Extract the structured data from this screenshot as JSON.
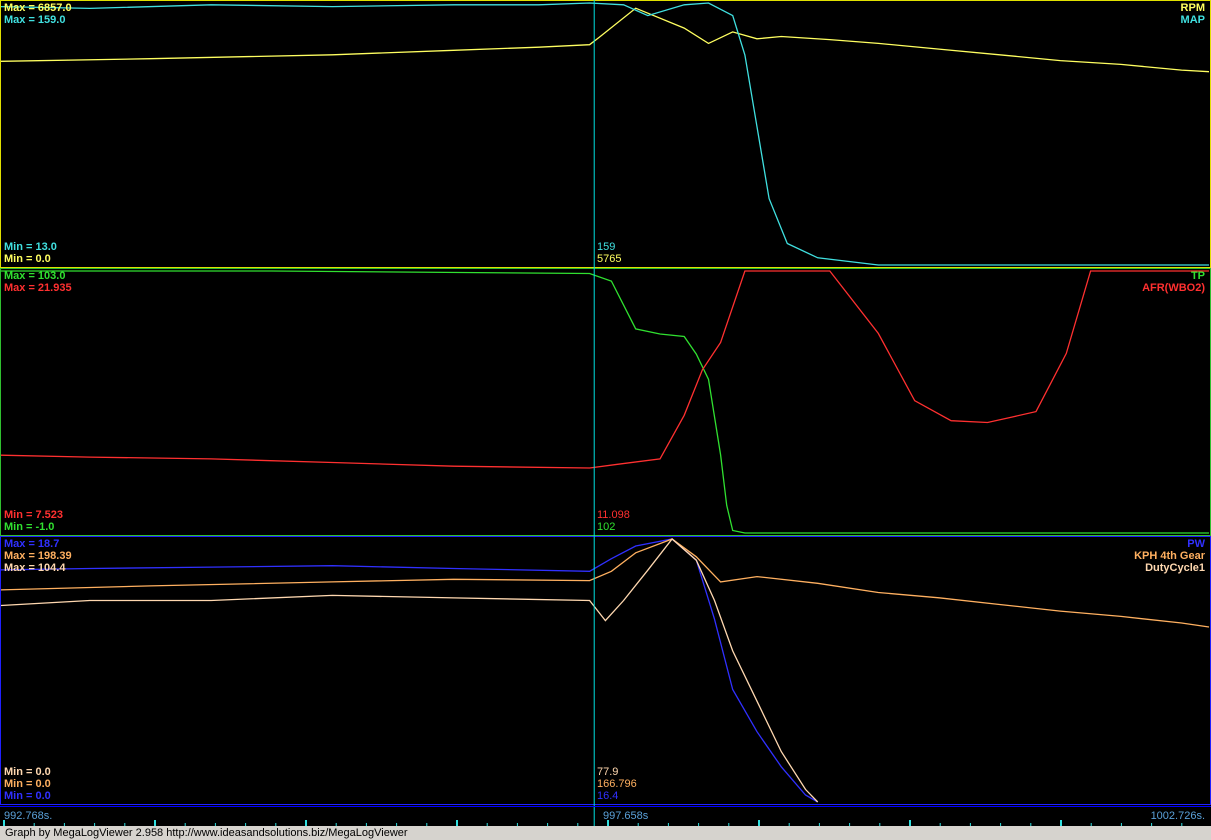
{
  "footer_text": "Graph by MegaLogViewer 2.958 http://www.ideasandsolutions.biz/MegaLogViewer",
  "x_axis": {
    "start_label": "992.768s.",
    "cursor_label": "997.658s",
    "end_label": "1002.726s.",
    "start": 992.768,
    "cursor": 997.658,
    "end": 1002.726
  },
  "colors": {
    "panel_border": "#ffff00",
    "cursor": "#00e0e0",
    "axis_line": "#0000ff",
    "bottom_border": "#2020ff"
  },
  "panels": [
    {
      "border_color": "#e0e000",
      "maxes": [
        {
          "text": "Max = 6857.0",
          "color": "#ffff60"
        },
        {
          "text": "Max = 159.0",
          "color": "#40e0e0"
        }
      ],
      "mins": [
        {
          "text": "Min = 13.0",
          "color": "#40e0e0"
        },
        {
          "text": "Min = 0.0",
          "color": "#ffff60"
        }
      ],
      "names": [
        {
          "text": "RPM",
          "color": "#ffff60"
        },
        {
          "text": "MAP",
          "color": "#40e0e0"
        }
      ],
      "cursor_values": [
        {
          "text": "159",
          "color": "#40e0e0"
        },
        {
          "text": "5765",
          "color": "#ffff60"
        }
      ]
    },
    {
      "border_color": "#30c030",
      "maxes": [
        {
          "text": "Max = 103.0",
          "color": "#30e030"
        },
        {
          "text": "Max = 21.935",
          "color": "#ff3030"
        }
      ],
      "mins": [
        {
          "text": "Min = 7.523",
          "color": "#ff3030"
        },
        {
          "text": "Min = -1.0",
          "color": "#30e030"
        }
      ],
      "names": [
        {
          "text": "TP",
          "color": "#30e030"
        },
        {
          "text": "AFR(WBO2)",
          "color": "#ff3030"
        }
      ],
      "cursor_values": [
        {
          "text": "11.098",
          "color": "#ff3030"
        },
        {
          "text": "102",
          "color": "#30e030"
        }
      ]
    },
    {
      "border_color": "#2020ff",
      "maxes": [
        {
          "text": "Max = 18.7",
          "color": "#3030ff"
        },
        {
          "text": "Max = 198.39",
          "color": "#ffb060"
        },
        {
          "text": "Max = 104.4",
          "color": "#ffd8b0"
        }
      ],
      "mins": [
        {
          "text": "Min = 0.0",
          "color": "#ffd8b0"
        },
        {
          "text": "Min = 0.0",
          "color": "#ffb060"
        },
        {
          "text": "Min = 0.0",
          "color": "#3030ff"
        }
      ],
      "names": [
        {
          "text": "PW",
          "color": "#3030ff"
        },
        {
          "text": "KPH 4th Gear",
          "color": "#ffb060"
        },
        {
          "text": "DutyCycle1",
          "color": "#ffd8b0"
        }
      ],
      "cursor_values": [
        {
          "text": "77.9",
          "color": "#ffd8b0"
        },
        {
          "text": "166.796",
          "color": "#ffb060"
        },
        {
          "text": "16.4",
          "color": "#3030ff"
        }
      ]
    }
  ],
  "chart_data": {
    "type": "line",
    "x_range": [
      992.768,
      1002.726
    ],
    "cursor_x": 997.658,
    "panels": [
      {
        "series": [
          {
            "name": "RPM",
            "color": "#ffff60",
            "range": [
              0,
              6857
            ],
            "x": [
              992.768,
              994.0,
              995.5,
              996.5,
              997.2,
              997.62,
              997.7,
              998.0,
              998.4,
              998.6,
              998.8,
              999.0,
              999.2,
              999.6,
              1000.0,
              1000.5,
              1001.0,
              1001.5,
              1002.0,
              1002.5,
              1002.726
            ],
            "y": [
              5330,
              5400,
              5500,
              5620,
              5700,
              5765,
              5960,
              6720,
              6200,
              5800,
              6100,
              5920,
              5980,
              5900,
              5800,
              5650,
              5500,
              5350,
              5250,
              5100,
              5060
            ]
          },
          {
            "name": "MAP",
            "color": "#40e0e0",
            "range": [
              13,
              159
            ],
            "x": [
              992.768,
              993.5,
              994.5,
              995.5,
              996.5,
              997.2,
              997.62,
              997.9,
              998.1,
              998.4,
              998.6,
              998.8,
              998.9,
              999.0,
              999.1,
              999.25,
              999.5,
              1000.0,
              1000.2,
              1000.5,
              1001.0,
              1002.0,
              1002.726
            ],
            "y": [
              157,
              156,
              158,
              157,
              158,
              158,
              159,
              158,
              152,
              158,
              159,
              152,
              130,
              90,
              50,
              25,
              17,
              13,
              13,
              13,
              13,
              13,
              13
            ]
          }
        ]
      },
      {
        "series": [
          {
            "name": "TP",
            "color": "#30e030",
            "range": [
              -1,
              103
            ],
            "x": [
              992.768,
              995.0,
              997.62,
              997.8,
              998.0,
              998.2,
              998.4,
              998.5,
              998.6,
              998.7,
              998.75,
              998.8,
              998.9,
              1000.0,
              1002.726
            ],
            "y": [
              103,
              103,
              102,
              99,
              80,
              78,
              77,
              70,
              60,
              30,
              10,
              0,
              -1,
              -1,
              -1
            ]
          },
          {
            "name": "AFR(WBO2)",
            "color": "#ff3030",
            "range": [
              7.523,
              21.935
            ],
            "x": [
              992.768,
              993.5,
              994.5,
              995.5,
              996.5,
              997.62,
              997.85,
              998.2,
              998.4,
              998.55,
              998.7,
              998.9,
              999.1,
              999.3,
              999.6,
              1000.0,
              1000.3,
              1000.6,
              1000.9,
              1001.1,
              1001.3,
              1001.55,
              1001.75,
              1002.726
            ],
            "y": [
              11.8,
              11.7,
              11.6,
              11.4,
              11.2,
              11.1,
              11.3,
              11.6,
              14.0,
              16.5,
              18.0,
              21.935,
              21.935,
              21.935,
              21.935,
              18.5,
              14.8,
              13.7,
              13.6,
              13.9,
              14.2,
              17.4,
              21.935,
              21.935
            ]
          }
        ]
      },
      {
        "series": [
          {
            "name": "PW",
            "color": "#3030ff",
            "range": [
              0,
              18.7
            ],
            "x": [
              992.768,
              993.5,
              994.5,
              995.5,
              996.5,
              997.62,
              997.8,
              998.0,
              998.3,
              998.5,
              998.65,
              998.8,
              999.0,
              999.2,
              999.4,
              999.5
            ],
            "y": [
              16.5,
              16.6,
              16.7,
              16.8,
              16.6,
              16.4,
              17.3,
              18.2,
              18.7,
              17.2,
              13.0,
              8.0,
              5.0,
              2.5,
              0.5,
              0
            ]
          },
          {
            "name": "KPH 4th Gear",
            "color": "#ffb060",
            "range": [
              0,
              198.39
            ],
            "x": [
              992.768,
              994.0,
              995.5,
              996.5,
              997.62,
              997.8,
              998.0,
              998.3,
              998.5,
              998.7,
              999.0,
              999.5,
              1000.0,
              1000.5,
              1001.0,
              1001.5,
              1002.0,
              1002.5,
              1002.726
            ],
            "y": [
              160,
              163,
              166,
              168,
              167,
              174,
              188,
              198.39,
              185,
              166,
              170,
              165,
              158,
              154,
              149,
              144,
              140,
              135,
              132
            ]
          },
          {
            "name": "DutyCycle1",
            "color": "#ffd8b0",
            "range": [
              0,
              104.4
            ],
            "x": [
              992.768,
              993.5,
              994.5,
              995.5,
              996.5,
              997.62,
              997.75,
              997.9,
              998.1,
              998.3,
              998.5,
              998.65,
              998.8,
              999.0,
              999.2,
              999.4,
              999.5
            ],
            "y": [
              78,
              80,
              80,
              82,
              81,
              80,
              72,
              80,
              92,
              104.4,
              96,
              80,
              60,
              40,
              20,
              5,
              0
            ]
          }
        ]
      }
    ]
  }
}
